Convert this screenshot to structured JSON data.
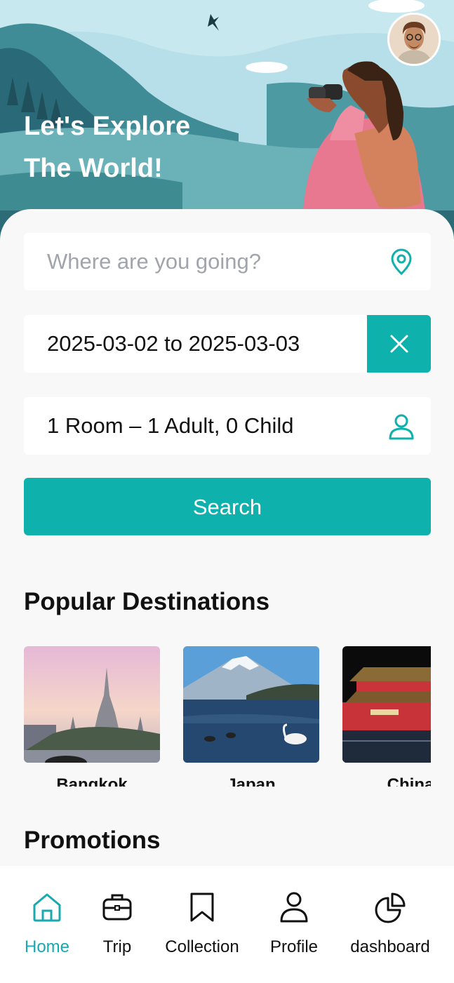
{
  "hero": {
    "title_line1": "Let's Explore",
    "title_line2": "The World!"
  },
  "search": {
    "destination_placeholder": "Where are you going?",
    "date_range": "2025-03-02 to 2025-03-03",
    "guests": "1 Room – 1 Adult, 0 Child",
    "search_label": "Search"
  },
  "popular": {
    "title": "Popular Destinations",
    "items": [
      {
        "name": "Bangkok"
      },
      {
        "name": "Japan"
      },
      {
        "name": "China"
      }
    ]
  },
  "promotions": {
    "title": "Promotions"
  },
  "nav": {
    "items": [
      {
        "label": "Home",
        "icon": "home-icon"
      },
      {
        "label": "Trip",
        "icon": "briefcase-icon"
      },
      {
        "label": "Collection",
        "icon": "bookmark-icon"
      },
      {
        "label": "Profile",
        "icon": "user-icon"
      },
      {
        "label": "dashboard",
        "icon": "pie-chart-icon"
      }
    ]
  },
  "colors": {
    "accent": "#0fb1ac",
    "active_nav": "#18aab0",
    "placeholder": "#a0a4ab"
  }
}
